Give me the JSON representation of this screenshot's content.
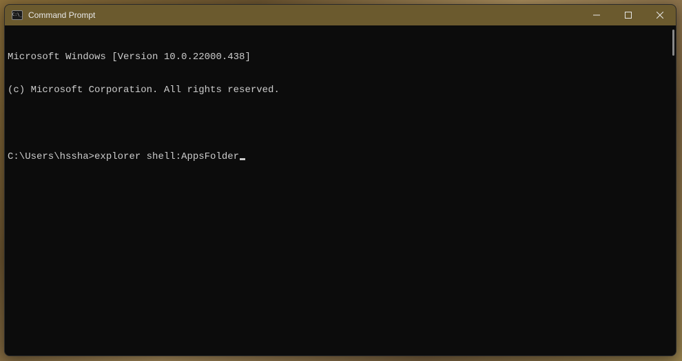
{
  "window": {
    "title": "Command Prompt"
  },
  "terminal": {
    "header_line1": "Microsoft Windows [Version 10.0.22000.438]",
    "header_line2": "(c) Microsoft Corporation. All rights reserved.",
    "prompt": "C:\\Users\\hssha>",
    "command": "explorer shell:AppsFolder"
  }
}
